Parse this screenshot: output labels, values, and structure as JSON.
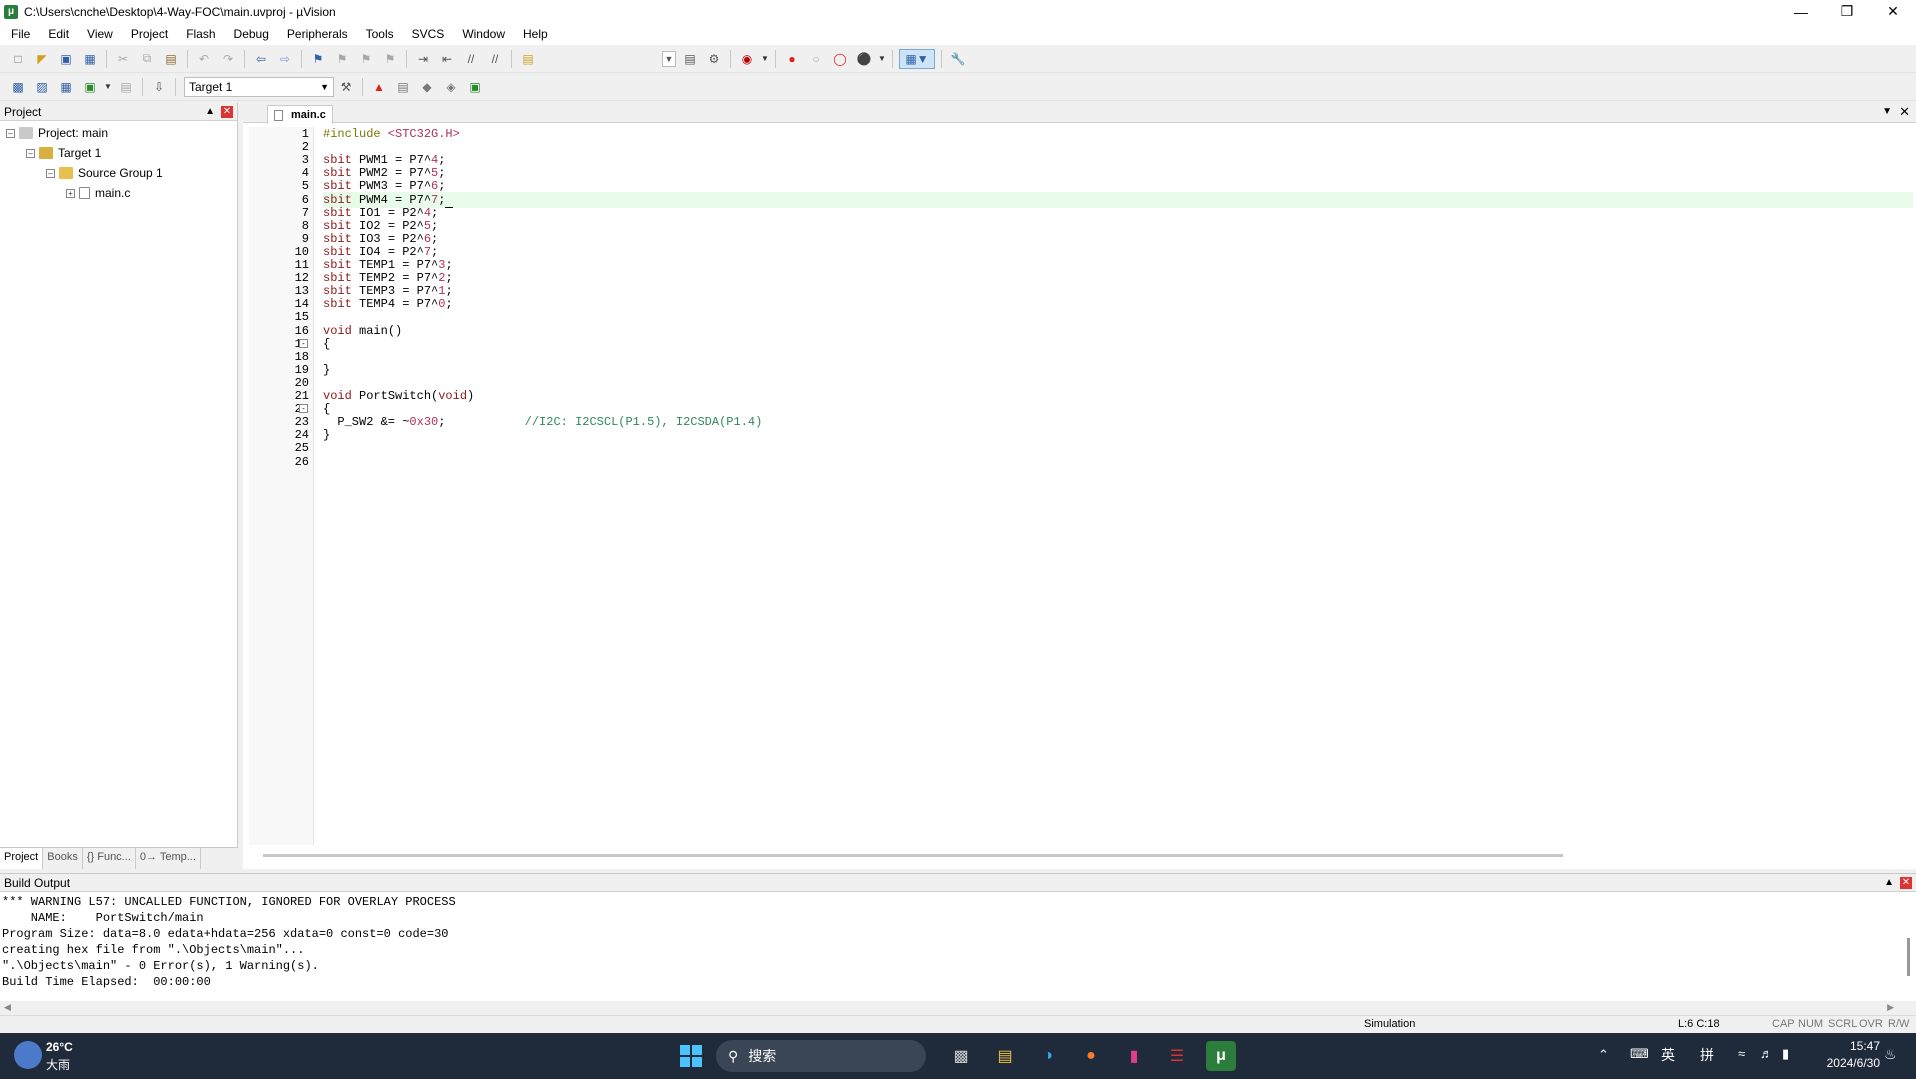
{
  "window": {
    "title": "C:\\Users\\cnche\\Desktop\\4-Way-FOC\\main.uvproj - µVision",
    "minimize_icon": "minimize-icon",
    "maximize_icon": "restore-icon",
    "close_icon": "close-icon"
  },
  "menu": [
    "File",
    "Edit",
    "View",
    "Project",
    "Flash",
    "Debug",
    "Peripherals",
    "Tools",
    "SVCS",
    "Window",
    "Help"
  ],
  "toolbar2": {
    "target_select": "Target 1"
  },
  "project_pane": {
    "title": "Project",
    "tree": {
      "project": "Project: main",
      "target": "Target 1",
      "group": "Source Group 1",
      "file": "main.c"
    },
    "tabs": [
      "Project",
      "Books",
      "{} Func...",
      "0→ Temp..."
    ]
  },
  "editor": {
    "tab_label": "main.c",
    "current_line": 6,
    "lines": [
      "#include <STC32G.H>",
      "",
      "sbit PWM1 = P7^4;",
      "sbit PWM2 = P7^5;",
      "sbit PWM3 = P7^6;",
      "sbit PWM4 = P7^7;",
      "sbit IO1 = P2^4;",
      "sbit IO2 = P2^5;",
      "sbit IO3 = P2^6;",
      "sbit IO4 = P2^7;",
      "sbit TEMP1 = P7^3;",
      "sbit TEMP2 = P7^2;",
      "sbit TEMP3 = P7^1;",
      "sbit TEMP4 = P7^0;",
      "",
      "void main()",
      "{",
      "",
      "}",
      "",
      "void PortSwitch(void)",
      "{",
      "  P_SW2 &= ~0x30;           //I2C: I2CSCL(P1.5), I2CSDA(P1.4)",
      "}",
      "",
      ""
    ]
  },
  "build_output": {
    "title": "Build Output",
    "lines": [
      "*** WARNING L57: UNCALLED FUNCTION, IGNORED FOR OVERLAY PROCESS",
      "    NAME:    PortSwitch/main",
      "Program Size: data=8.0 edata+hdata=256 xdata=0 const=0 code=30",
      "creating hex file from \".\\Objects\\main\"...",
      "\".\\Objects\\main\" - 0 Error(s), 1 Warning(s).",
      "Build Time Elapsed:  00:00:00"
    ]
  },
  "statusbar": {
    "mode": "Simulation",
    "position": "L:6 C:18",
    "indicators": [
      "CAP",
      "NUM",
      "SCRL",
      "OVR",
      "R/W"
    ]
  },
  "taskbar": {
    "weather_temp": "26°C",
    "weather_desc": "大雨",
    "search_placeholder": "搜索",
    "ime_lang": "英",
    "ime_mode": "拼",
    "time": "15:47",
    "date": "2024/6/30"
  }
}
